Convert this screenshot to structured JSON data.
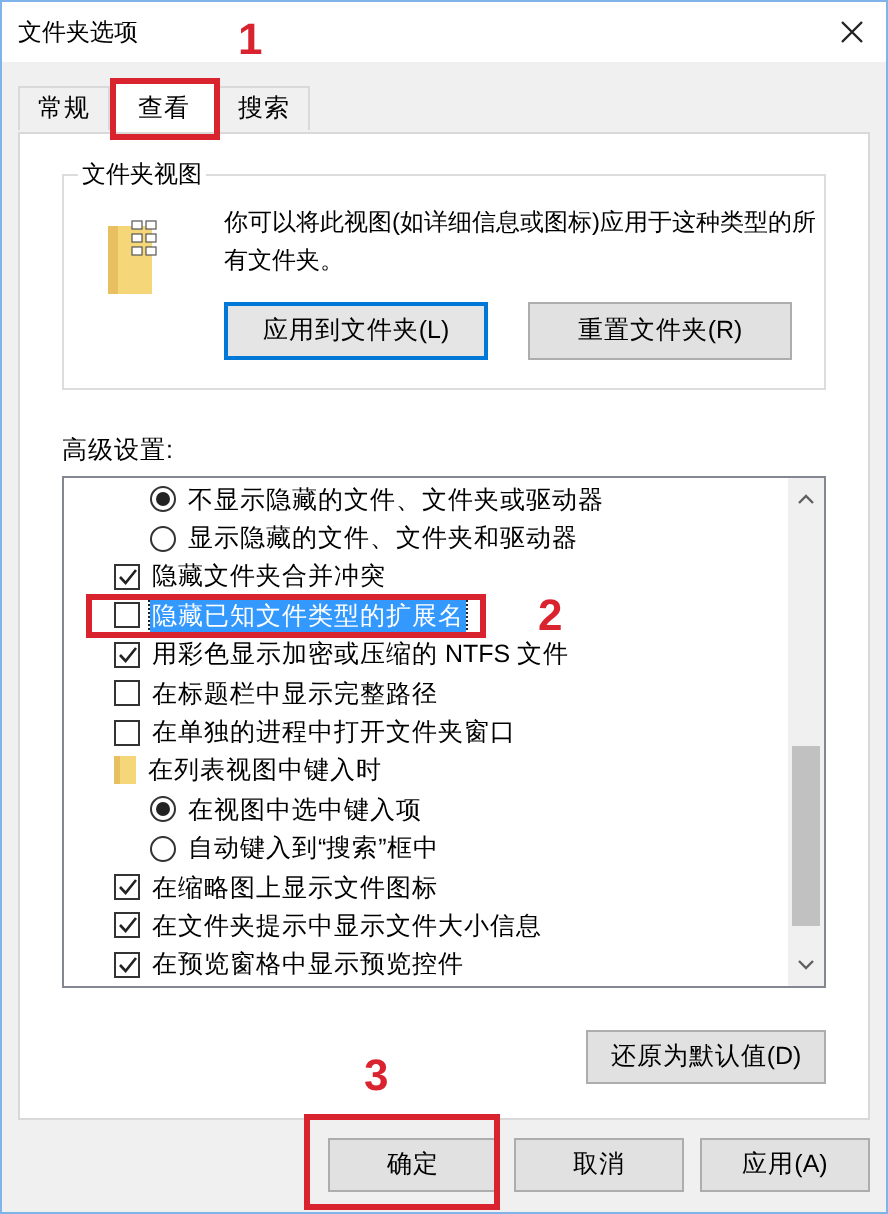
{
  "window": {
    "title": "文件夹选项"
  },
  "tabs": [
    {
      "label": "常规",
      "selected": false
    },
    {
      "label": "查看",
      "selected": true,
      "callout": "1"
    },
    {
      "label": "搜索",
      "selected": false
    }
  ],
  "folder_views": {
    "title": "文件夹视图",
    "description": "你可以将此视图(如详细信息或图标)应用于这种类型的所有文件夹。",
    "buttons": [
      {
        "label": "应用到文件夹(L)",
        "focused": true
      },
      {
        "label": "重置文件夹(R)",
        "focused": false
      }
    ]
  },
  "advanced": {
    "title": "高级设置:",
    "items": [
      {
        "kind": "radio",
        "label": "不显示隐藏的文件、文件夹或驱动器",
        "checked": true,
        "selected": false
      },
      {
        "kind": "radio",
        "label": "显示隐藏的文件、文件夹和驱动器",
        "checked": false,
        "selected": false
      },
      {
        "kind": "checkbox",
        "label": "隐藏文件夹合并冲突",
        "checked": true,
        "selected": false
      },
      {
        "kind": "checkbox",
        "label": "隐藏已知文件类型的扩展名",
        "checked": false,
        "selected": true,
        "callout": "2"
      },
      {
        "kind": "checkbox",
        "label": "用彩色显示加密或压缩的 NTFS 文件",
        "checked": true,
        "selected": false
      },
      {
        "kind": "checkbox",
        "label": "在标题栏中显示完整路径",
        "checked": false,
        "selected": false
      },
      {
        "kind": "checkbox",
        "label": "在单独的进程中打开文件夹窗口",
        "checked": false,
        "selected": false
      },
      {
        "kind": "folder",
        "label": "在列表视图中键入时",
        "selected": false,
        "children": [
          {
            "kind": "radio",
            "label": "在视图中选中键入项",
            "checked": true,
            "selected": false
          },
          {
            "kind": "radio",
            "label": "自动键入到“搜索”框中",
            "checked": false,
            "selected": false
          }
        ]
      },
      {
        "kind": "checkbox",
        "label": "在缩略图上显示文件图标",
        "checked": true,
        "selected": false
      },
      {
        "kind": "checkbox",
        "label": "在文件夹提示中显示文件大小信息",
        "checked": true,
        "selected": false
      },
      {
        "kind": "checkbox",
        "label": "在预览窗格中显示预览控件",
        "checked": true,
        "selected": false
      }
    ],
    "restore_button": "还原为默认值(D)"
  },
  "buttons": [
    {
      "label": "确定",
      "callout": "3"
    },
    {
      "label": "取消"
    },
    {
      "label": "应用(A)"
    }
  ]
}
